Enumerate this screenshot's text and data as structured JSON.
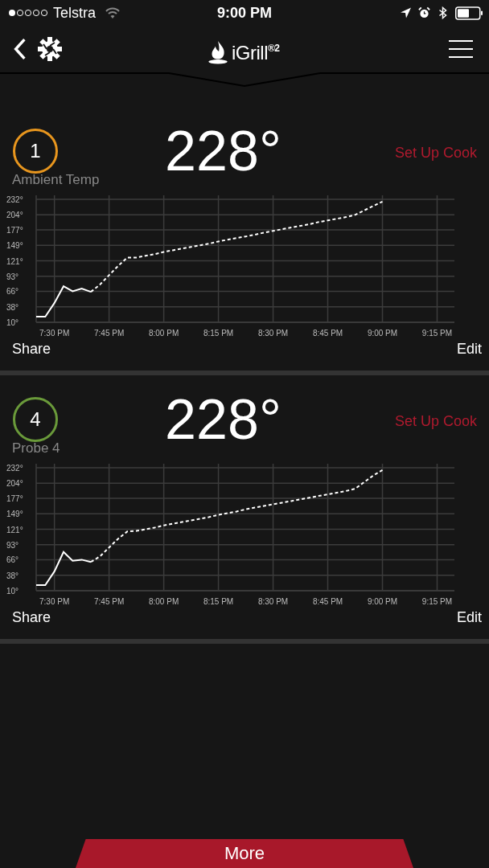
{
  "status_bar": {
    "carrier": "Telstra",
    "time": "9:00 PM"
  },
  "nav": {
    "logo": "iGrill$^{®2}$"
  },
  "probes": [
    {
      "number": "1",
      "color": "#e8961e",
      "temperature": "228°",
      "action": "Set Up Cook",
      "name": "Ambient Temp",
      "share": "Share",
      "edit": "Edit",
      "chart_data": {
        "type": "line",
        "categories": [
          null,
          null,
          "7:30 PM",
          null,
          null,
          null,
          null,
          null,
          "7:45 PM",
          null,
          null,
          null,
          null,
          null,
          "8:00 PM",
          null,
          null,
          null,
          null,
          null,
          "8:15 PM",
          null,
          null,
          null,
          null,
          null,
          "8:30 PM",
          null,
          null,
          null,
          null,
          null,
          "8:45 PM",
          null,
          null,
          null,
          null,
          null,
          "9:00 PM",
          null,
          null,
          null,
          null,
          null,
          "9:15 PM",
          null
        ],
        "series": [
          {
            "color": "#ffffff",
            "line_style": "solid",
            "values": [
              20,
              20,
              45,
              75,
              66,
              71,
              65,
              null,
              null,
              null,
              null,
              null,
              null,
              null,
              null,
              null,
              null,
              null,
              null,
              null,
              null,
              null,
              null,
              null,
              null,
              null,
              null,
              null,
              null,
              null,
              null,
              null,
              null,
              null,
              null,
              null,
              null,
              null,
              null,
              null,
              null,
              null,
              null,
              null,
              null,
              null
            ]
          },
          {
            "color": "#ffffff",
            "line_style": "dashed",
            "values": [
              null,
              null,
              null,
              null,
              null,
              null,
              65,
              78,
              95,
              112,
              127,
              127,
              130,
              133,
              137,
              140,
              143,
              146,
              149,
              152,
              156,
              159,
              162,
              165,
              168,
              172,
              175,
              178,
              181,
              184,
              187,
              191,
              194,
              197,
              200,
              204,
              212,
              220,
              228,
              null,
              null,
              null,
              null,
              null,
              null,
              null
            ]
          }
        ],
        "ylim": [
          10,
          232
        ],
        "grid": true,
        "yticks": [
          {
            "value": 10,
            "label": "10°"
          },
          {
            "value": 38,
            "label": "38°"
          },
          {
            "value": 66,
            "label": "66°"
          },
          {
            "value": 93,
            "label": "93°"
          },
          {
            "value": 121,
            "label": "121°"
          },
          {
            "value": 149,
            "label": "149°"
          },
          {
            "value": 177,
            "label": "177°"
          },
          {
            "value": 204,
            "label": "204°"
          },
          {
            "value": 232,
            "label": "232°"
          }
        ]
      }
    },
    {
      "number": "4",
      "color": "#6a9a3a",
      "temperature": "228°",
      "action": "Set Up Cook",
      "name": "Probe 4",
      "share": "Share",
      "edit": "Edit",
      "chart_data": {
        "type": "line",
        "categories": [
          null,
          null,
          "7:30 PM",
          null,
          null,
          null,
          null,
          null,
          "7:45 PM",
          null,
          null,
          null,
          null,
          null,
          "8:00 PM",
          null,
          null,
          null,
          null,
          null,
          "8:15 PM",
          null,
          null,
          null,
          null,
          null,
          "8:30 PM",
          null,
          null,
          null,
          null,
          null,
          "8:45 PM",
          null,
          null,
          null,
          null,
          null,
          "9:00 PM",
          null,
          null,
          null,
          null,
          null,
          "9:15 PM",
          null
        ],
        "series": [
          {
            "color": "#ffffff",
            "line_style": "solid",
            "values": [
              20,
              20,
              45,
              80,
              64,
              66,
              62,
              null,
              null,
              null,
              null,
              null,
              null,
              null,
              null,
              null,
              null,
              null,
              null,
              null,
              null,
              null,
              null,
              null,
              null,
              null,
              null,
              null,
              null,
              null,
              null,
              null,
              null,
              null,
              null,
              null,
              null,
              null,
              null,
              null,
              null,
              null,
              null,
              null,
              null,
              null
            ]
          },
          {
            "color": "#ffffff",
            "line_style": "dashed",
            "values": [
              null,
              null,
              null,
              null,
              null,
              null,
              62,
              72,
              88,
              104,
              117,
              118,
              121,
              124,
              128,
              131,
              134,
              137,
              140,
              143,
              147,
              150,
              153,
              157,
              160,
              163,
              166,
              169,
              172,
              175,
              178,
              181,
              184,
              187,
              190,
              194,
              206,
              218,
              228,
              null,
              null,
              null,
              null,
              null,
              null,
              null
            ]
          }
        ],
        "ylim": [
          10,
          232
        ],
        "grid": true,
        "yticks": [
          {
            "value": 10,
            "label": "10°"
          },
          {
            "value": 38,
            "label": "38°"
          },
          {
            "value": 66,
            "label": "66°"
          },
          {
            "value": 93,
            "label": "93°"
          },
          {
            "value": 121,
            "label": "121°"
          },
          {
            "value": 149,
            "label": "149°"
          },
          {
            "value": 177,
            "label": "177°"
          },
          {
            "value": 204,
            "label": "204°"
          },
          {
            "value": 232,
            "label": "232°"
          }
        ]
      }
    }
  ],
  "more_button": "More"
}
